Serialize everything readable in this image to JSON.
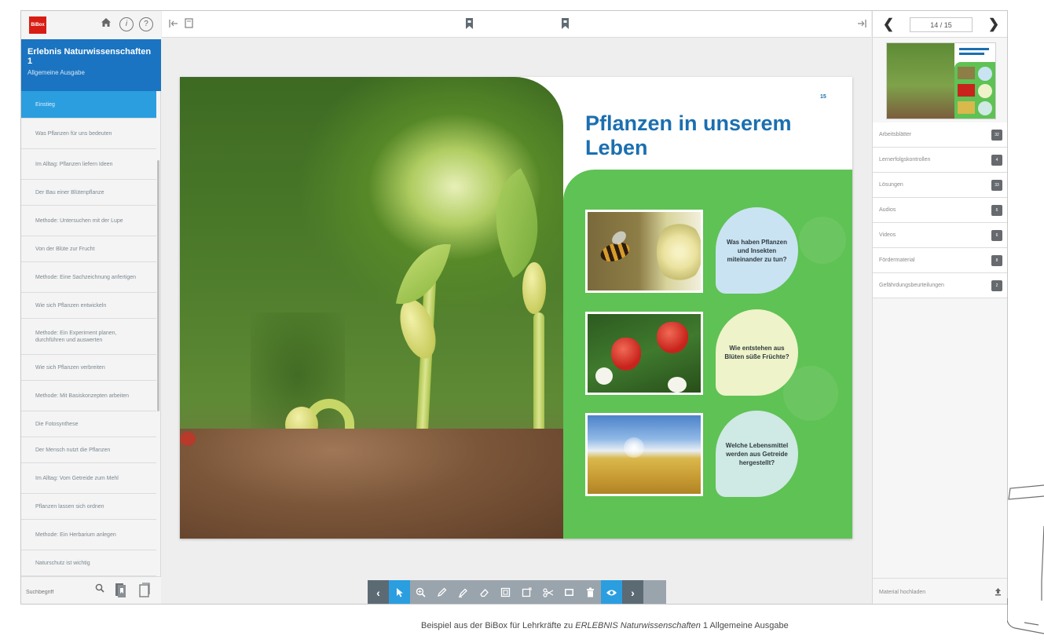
{
  "app": {
    "logo_text": "BiBox",
    "book_title": "Erlebnis Naturwissenschaften 1",
    "book_subtitle": "Allgemeine Ausgabe"
  },
  "sidebar": {
    "icons": [
      "home-icon",
      "info-icon",
      "help-icon"
    ],
    "items": [
      {
        "label": "Einstieg",
        "active": true
      },
      {
        "label": "Was Pflanzen für uns bedeuten"
      },
      {
        "label": "Im Alltag: Pflanzen liefern Ideen"
      },
      {
        "label": "Der Bau einer Blütenpflanze"
      },
      {
        "label": "Methode: Untersuchen mit der Lupe"
      },
      {
        "label": "Von der Blüte zur Frucht"
      },
      {
        "label": "Methode: Eine Sachzeichnung anfertigen"
      },
      {
        "label": "Wie sich Pflanzen entwickeln"
      },
      {
        "label": "Methode: Ein Experiment planen, durchführen und auswerten"
      },
      {
        "label": "Wie sich Pflanzen verbreiten"
      },
      {
        "label": "Methode: Mit Basiskonzepten arbeiten"
      },
      {
        "label": "Die Fotosynthese"
      },
      {
        "label": "Der Mensch nutzt die Pflanzen"
      },
      {
        "label": "Im Alltag: Vom Getreide zum Mehl"
      },
      {
        "label": "Pflanzen lassen sich ordnen"
      },
      {
        "label": "Methode: Ein Herbarium anlegen"
      },
      {
        "label": "Naturschutz ist wichtig"
      }
    ],
    "search_placeholder": "Suchbegriff"
  },
  "viewer": {
    "page_title": "Pflanzen in unserem Leben",
    "page_mark": "15",
    "questions": [
      "Was haben Pflanzen und Insekten miteinander zu tun?",
      "Wie entstehen aus Blüten süße Früchte?",
      "Welche Lebensmittel werden aus Getreide hergestellt?"
    ],
    "bubble_colors": [
      "#c9e3f3",
      "#eef3c9",
      "#cfe9e5"
    ]
  },
  "navigation": {
    "page_indicator": "14 / 15"
  },
  "materials": {
    "items": [
      {
        "label": "Arbeitsblätter",
        "count": "32"
      },
      {
        "label": "Lernerfolgskontrollen",
        "count": "4"
      },
      {
        "label": "Lösungen",
        "count": "33"
      },
      {
        "label": "Audios",
        "count": "6"
      },
      {
        "label": "Videos",
        "count": "6"
      },
      {
        "label": "Fördermaterial",
        "count": "8"
      },
      {
        "label": "Gefährdungsbeurteilungen",
        "count": "2"
      }
    ],
    "upload_label": "Material hochladen"
  },
  "caption": {
    "prefix": "Beispiel aus der BiBox für Lehrkräfte zu ",
    "title": "ERLEBNIS Naturwissenschaften",
    "suffix": " 1 Allgemeine Ausgabe"
  },
  "colors": {
    "brand_red": "#d81e14",
    "header_blue": "#1a74c1",
    "active_blue": "#2b9ee0",
    "page_green": "#5fc254",
    "title_blue": "#1b6fb0"
  }
}
